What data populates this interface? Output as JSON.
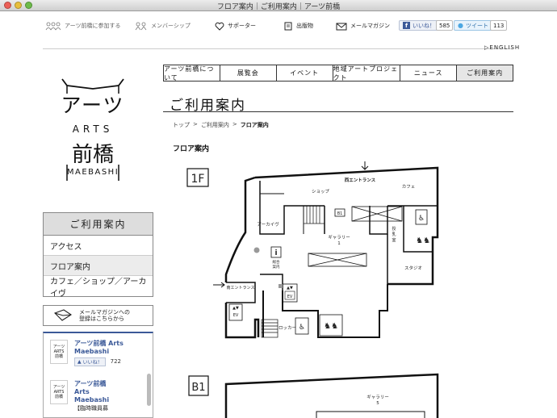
{
  "window": {
    "title": "フロア案内｜ご利用案内｜アーツ前橋"
  },
  "topnav": {
    "join": "アーツ前橋に参加する",
    "membership": "メンバーシップ",
    "supporter": "サポーター",
    "publications": "出版物",
    "mail_magazine": "メールマガジン",
    "fb_like": "いいね！",
    "fb_count": "585",
    "tweet": "ツイート",
    "tweet_count": "113"
  },
  "language_link": "ENGLISH",
  "logo": {
    "line1": "アーツ",
    "line2": "ARTS",
    "line3": "前橋",
    "line4": "MAEBASHI"
  },
  "mainnav": {
    "tabs": [
      {
        "label": "アーツ前橋について"
      },
      {
        "label": "展覧会"
      },
      {
        "label": "イベント"
      },
      {
        "label": "地域アートプロジェクト"
      },
      {
        "label": "ニュース"
      },
      {
        "label": "ご利用案内"
      }
    ]
  },
  "page": {
    "title": "ご利用案内",
    "breadcrumb": [
      "トップ",
      ">",
      "ご利用案内",
      ">",
      "フロア案内"
    ],
    "section_title": "フロア案内"
  },
  "sidebar": {
    "heading": "ご利用案内",
    "items": [
      {
        "label": "アクセス"
      },
      {
        "label": "フロア案内"
      },
      {
        "label": "カフェ／ショップ／アーカイヴ"
      }
    ],
    "mail": {
      "line1": "メールマガジンへの",
      "line2": "登録はこちらから"
    },
    "facebook": {
      "page_name": "アーツ前橋 Arts Maebashi",
      "page_name_1": "アーツ前橋 Arts",
      "page_name_2": "Maebashi",
      "like": "いいね！",
      "count": "722",
      "post_name_1": "アーツ前橋",
      "post_name_2": "Arts",
      "post_name_3": "Maebashi",
      "post_text": "【臨時職員募"
    }
  },
  "floormap": {
    "floor_1f": "1F",
    "floor_b1": "B1",
    "rooms": {
      "west_entrance": "西エントランス",
      "shop": "ショップ",
      "cafe": "カフェ",
      "archive": "アーカイヴ",
      "gallery_label": "ギャラリー",
      "gallery_1": "1",
      "info_1": "総合",
      "info_2": "案内",
      "nursing_1": "授",
      "nursing_2": "乳",
      "nursing_3": "室",
      "studio": "スタジオ",
      "south_entrance": "南エントランス",
      "locker": "ロッカー",
      "gallery_5": "5"
    },
    "markers": {
      "b1": "B1",
      "ev": "EV"
    }
  }
}
